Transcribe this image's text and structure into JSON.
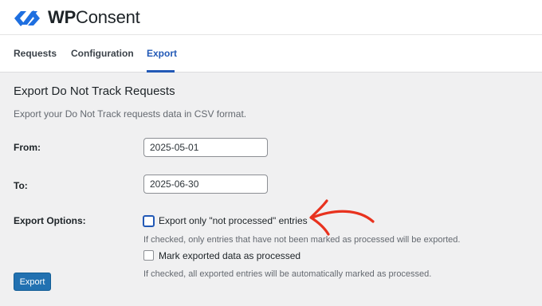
{
  "brand": {
    "name_bold": "WP",
    "name_rest": "Consent",
    "logo_color": "#1e6fe0"
  },
  "tabs": [
    {
      "label": "Requests",
      "active": false
    },
    {
      "label": "Configuration",
      "active": false
    },
    {
      "label": "Export",
      "active": true
    }
  ],
  "page": {
    "title": "Export Do Not Track Requests",
    "description": "Export your Do Not Track requests data in CSV format."
  },
  "form": {
    "from_label": "From:",
    "from_value": "2025-05-01",
    "to_label": "To:",
    "to_value": "2025-06-30",
    "options_label": "Export Options:",
    "option_not_processed": {
      "label": "Export only \"not processed\" entries",
      "checked": false,
      "help": "If checked, only entries that have not been marked as processed will be exported."
    },
    "option_mark_processed": {
      "label": "Mark exported data as processed",
      "checked": false,
      "help": "If checked, all exported entries will be automatically marked as processed."
    },
    "submit_label": "Export"
  },
  "annotation": {
    "arrow_color": "#e8321e",
    "arrow_icon": "hand-drawn-arrow-icon"
  },
  "colors": {
    "accent": "#2259b6",
    "button": "#2271b1",
    "background": "#f0f0f1"
  }
}
